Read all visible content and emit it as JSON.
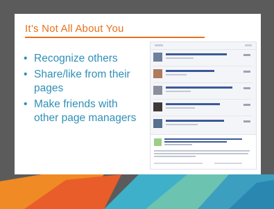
{
  "slide": {
    "title": "It’s Not All About You",
    "bullets": [
      "Recognize others",
      "Share/like from their pages",
      "Make friends with other page managers"
    ]
  },
  "colors": {
    "title": "#e8701a",
    "bullet_text": "#2f8fb8",
    "frame": "#5b5b5b",
    "card": "#ffffff"
  },
  "thumbnail": {
    "icon": "facebook-page-list-screenshot"
  }
}
